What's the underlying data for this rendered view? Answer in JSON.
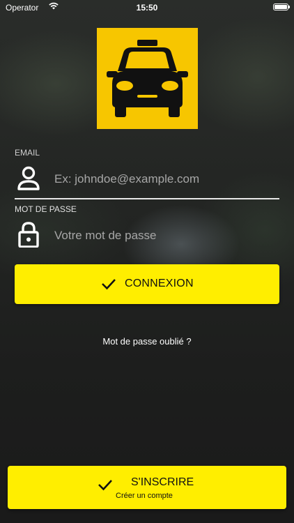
{
  "status_bar": {
    "carrier": "Operator",
    "time": "15:50"
  },
  "logo": {
    "icon": "taxi-icon",
    "background_color": "#f7c600"
  },
  "login_form": {
    "email": {
      "label": "EMAIL",
      "icon": "user-icon",
      "placeholder": "Ex: johndoe@example.com",
      "value": ""
    },
    "password": {
      "label": "MOT DE PASSE",
      "icon": "lock-icon",
      "placeholder": "Votre mot de passe",
      "value": ""
    },
    "login_button": {
      "icon": "check-icon",
      "label": "CONNEXION"
    },
    "forgot_password": "Mot de passe oublié ?"
  },
  "signup_button": {
    "icon": "check-icon",
    "label": "S'INSCRIRE",
    "sublabel": "Créer un compte"
  },
  "colors": {
    "accent": "#ffee00",
    "logo_yellow": "#f7c600"
  }
}
